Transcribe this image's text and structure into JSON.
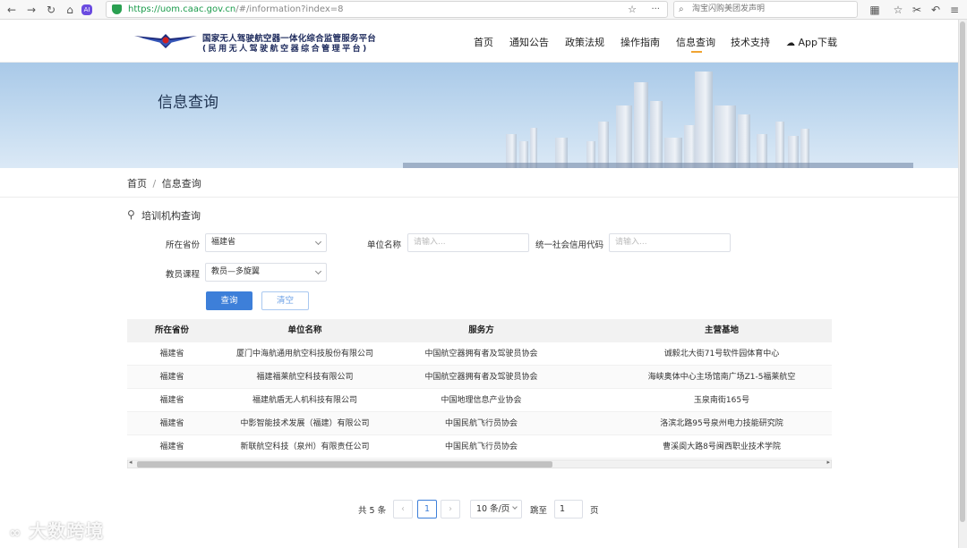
{
  "browser": {
    "url_host": "https://uom.caac.gov.cn",
    "url_path": "/#/information?index=8",
    "search_text": "淘宝闪购美团发声明",
    "menu_dots": "···"
  },
  "header": {
    "logo_line1": "国家无人驾驶航空器一体化综合监管服务平台",
    "logo_line2": "(民用无人驾驶航空器综合管理平台)",
    "nav": [
      "首页",
      "通知公告",
      "政策法规",
      "操作指南",
      "信息查询",
      "技术支持",
      "App下载"
    ],
    "active_nav": "信息查询"
  },
  "banner": {
    "title": "信息查询"
  },
  "breadcrumb": {
    "home": "首页",
    "sep": "/",
    "current": "信息查询"
  },
  "section": {
    "title": "培训机构查询"
  },
  "form": {
    "province_label": "所在省份",
    "province_value": "福建省",
    "unit_label": "单位名称",
    "unit_placeholder": "请输入...",
    "credit_label": "统一社会信用代码",
    "credit_placeholder": "请输入...",
    "course_label": "教员课程",
    "course_value": "教员—多旋翼",
    "query_button": "查询",
    "clear_button": "清空"
  },
  "table": {
    "headers": [
      "所在省份",
      "单位名称",
      "服务方",
      "主营基地"
    ],
    "rows": [
      [
        "福建省",
        "厦门中海航通用航空科技股份有限公司",
        "中国航空器拥有者及驾驶员协会",
        "诚毅北大街71号软件园体育中心"
      ],
      [
        "福建省",
        "福建福莱航空科技有限公司",
        "中国航空器拥有者及驾驶员协会",
        "海峡奥体中心主场馆南广场Z1-5福莱航空"
      ],
      [
        "福建省",
        "福建航盾无人机科技有限公司",
        "中国地理信息产业协会",
        "玉泉南街165号"
      ],
      [
        "福建省",
        "中影智能技术发展（福建）有限公司",
        "中国民航飞行员协会",
        "洛滨北路95号泉州电力技能研究院"
      ],
      [
        "福建省",
        "新联航空科技（泉州）有限责任公司",
        "中国民航飞行员协会",
        "曹溪阆大路8号闽西职业技术学院"
      ]
    ]
  },
  "pagination": {
    "total": "共 5 条",
    "current_page": "1",
    "page_size": "10 条/页",
    "jump_label": "跳至",
    "jump_value": "1",
    "page_suffix": "页",
    "prev": "‹",
    "next": "›"
  },
  "watermark": "大数跨境",
  "colors": {
    "primary": "#3d7fd9",
    "nav_underline": "#f0a431",
    "url_green": "#1a9b4b"
  }
}
